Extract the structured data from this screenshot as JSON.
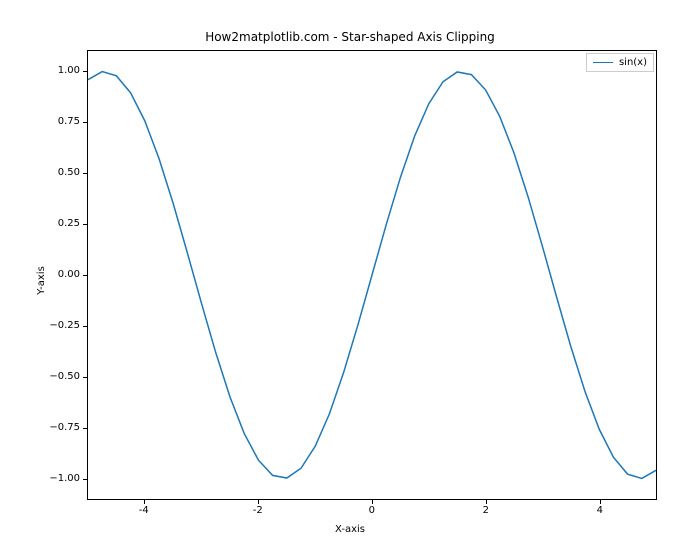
{
  "chart_data": {
    "type": "line",
    "title": "How2matplotlib.com - Star-shaped Axis Clipping",
    "xlabel": "X-axis",
    "ylabel": "Y-axis",
    "xlim": [
      -5,
      5
    ],
    "ylim": [
      -1.1,
      1.1
    ],
    "xticks": [
      -4,
      -2,
      0,
      2,
      4
    ],
    "yticks": [
      -1.0,
      -0.75,
      -0.5,
      -0.25,
      0.0,
      0.25,
      0.5,
      0.75,
      1.0
    ],
    "series": [
      {
        "name": "sin(x)",
        "x": [
          -5.0,
          -4.75,
          -4.5,
          -4.25,
          -4.0,
          -3.75,
          -3.5,
          -3.25,
          -3.0,
          -2.75,
          -2.5,
          -2.25,
          -2.0,
          -1.75,
          -1.5,
          -1.25,
          -1.0,
          -0.75,
          -0.5,
          -0.25,
          0.0,
          0.25,
          0.5,
          0.75,
          1.0,
          1.25,
          1.5,
          1.75,
          2.0,
          2.25,
          2.5,
          2.75,
          3.0,
          3.25,
          3.5,
          3.75,
          4.0,
          4.25,
          4.5,
          4.75,
          5.0
        ],
        "y": [
          0.959,
          0.999,
          0.978,
          0.895,
          0.757,
          0.572,
          0.351,
          0.108,
          -0.141,
          -0.382,
          -0.599,
          -0.778,
          -0.909,
          -0.984,
          -0.997,
          -0.949,
          -0.841,
          -0.682,
          -0.479,
          -0.247,
          0.0,
          0.247,
          0.479,
          0.682,
          0.841,
          0.949,
          0.997,
          0.984,
          0.909,
          0.778,
          0.599,
          0.382,
          0.141,
          -0.108,
          -0.351,
          -0.572,
          -0.757,
          -0.895,
          -0.978,
          -0.999,
          -0.959
        ]
      }
    ],
    "legend": {
      "entries": [
        "sin(x)"
      ],
      "position": "upper right"
    },
    "colors": {
      "line": "#1f77b4"
    }
  }
}
